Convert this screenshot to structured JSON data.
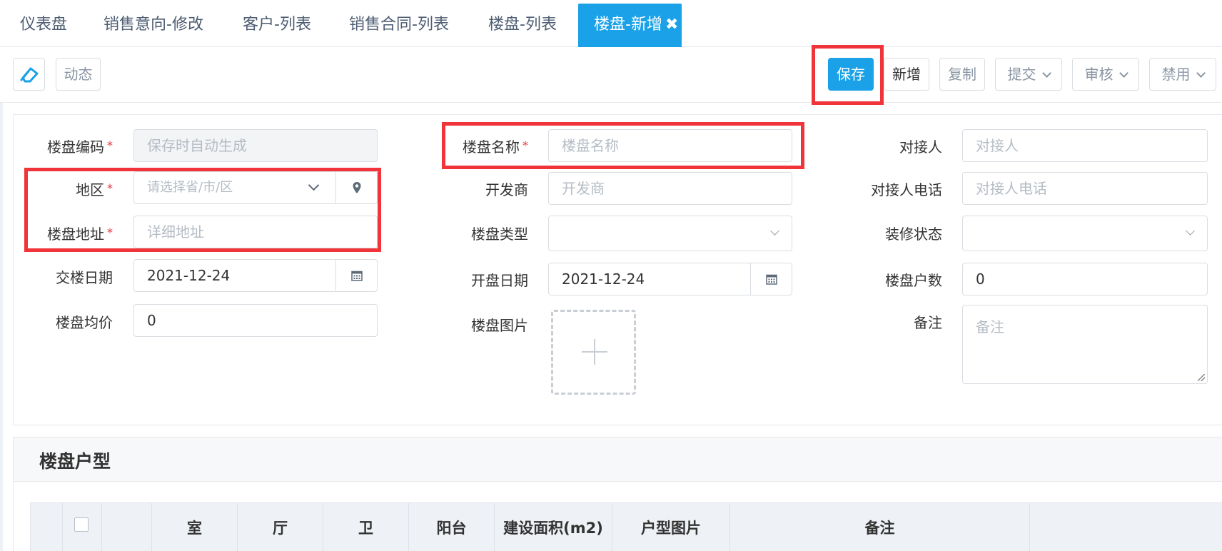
{
  "tabs": [
    {
      "label": "仪表盘"
    },
    {
      "label": "销售意向-修改"
    },
    {
      "label": "客户-列表"
    },
    {
      "label": "销售合同-列表"
    },
    {
      "label": "楼盘-列表"
    },
    {
      "label": "楼盘-新增",
      "active": true
    }
  ],
  "toolbar": {
    "dynamic_label": "动态",
    "save_label": "保存",
    "new_label": "新增",
    "copy_label": "复制",
    "submit_label": "提交",
    "audit_label": "审核",
    "disable_label": "禁用"
  },
  "form": {
    "code_label": "楼盘编码",
    "code_placeholder": "保存时自动生成",
    "region_label": "地区",
    "region_placeholder": "请选择省/市/区",
    "address_label": "楼盘地址",
    "address_placeholder": "详细地址",
    "delivery_date_label": "交楼日期",
    "delivery_date_value": "2021-12-24",
    "avg_price_label": "楼盘均价",
    "avg_price_value": "0",
    "name_label": "楼盘名称",
    "name_placeholder": "楼盘名称",
    "developer_label": "开发商",
    "developer_placeholder": "开发商",
    "type_label": "楼盘类型",
    "open_date_label": "开盘日期",
    "open_date_value": "2021-12-24",
    "image_label": "楼盘图片",
    "contact_label": "对接人",
    "contact_placeholder": "对接人",
    "contact_phone_label": "对接人电话",
    "contact_phone_placeholder": "对接人电话",
    "decoration_label": "装修状态",
    "households_label": "楼盘户数",
    "households_value": "0",
    "remark_label": "备注",
    "remark_placeholder": "备注"
  },
  "unit_section": {
    "title": "楼盘户型",
    "columns": [
      "室",
      "厅",
      "卫",
      "阳台",
      "建设面积(m2)",
      "户型图片",
      "备注"
    ]
  }
}
